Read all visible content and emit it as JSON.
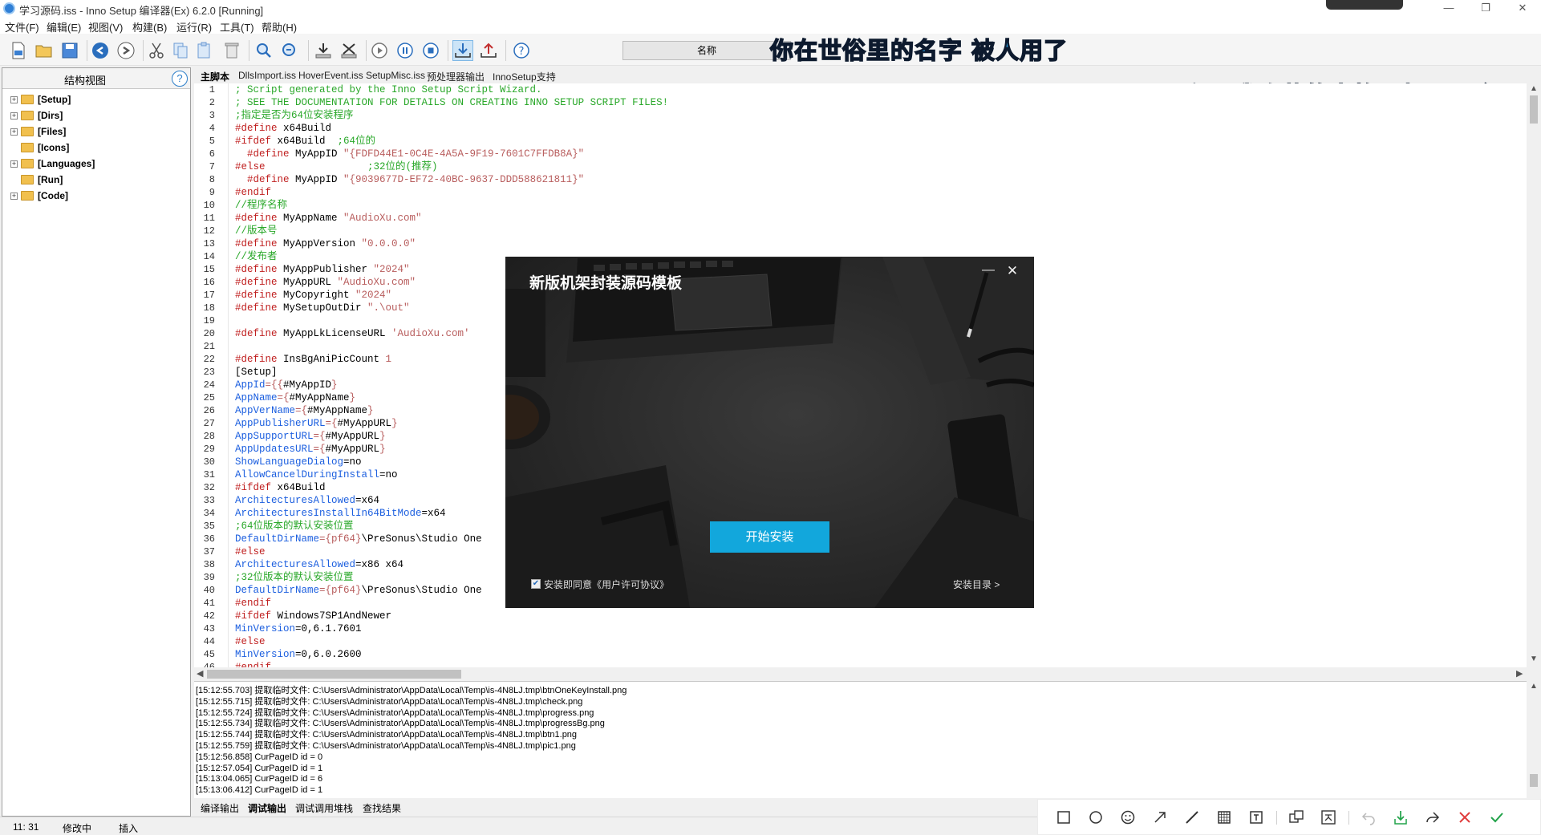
{
  "window": {
    "title": "学习源码.iss - Inno Setup 编译器(Ex) 6.2.0  [Running]",
    "recording_pill": "",
    "controls": [
      "—",
      "❐",
      "✕"
    ]
  },
  "menu": [
    "文件(F)",
    "编辑(E)",
    "视图(V)",
    "构建(B)",
    "运行(R)",
    "工具(T)",
    "帮助(H)"
  ],
  "toolbar": {
    "name_field_label": "名称",
    "icons": [
      "new-file-icon",
      "open-icon",
      "save-icon",
      "undo-icon",
      "redo-icon",
      "cut-icon",
      "copy-icon",
      "paste-icon",
      "delete-icon",
      "find-icon",
      "replace-icon",
      "compile-icon",
      "stop-compile-icon",
      "run-icon",
      "pause-icon",
      "stop-icon",
      "download-icon",
      "upload-icon",
      "help-icon"
    ]
  },
  "overlay": {
    "lyric_1": "你在世俗里的名字  被人用了",
    "lyric_2": "反正  我隐藏的人格是契而不舍"
  },
  "left_panel": {
    "title": "结构视图",
    "help": "?",
    "items": [
      {
        "label": "[Setup]",
        "expandable": true
      },
      {
        "label": "[Dirs]",
        "expandable": true
      },
      {
        "label": "[Files]",
        "expandable": true
      },
      {
        "label": "[Icons]",
        "expandable": false
      },
      {
        "label": "[Languages]",
        "expandable": true
      },
      {
        "label": "[Run]",
        "expandable": false
      },
      {
        "label": "[Code]",
        "expandable": true
      }
    ]
  },
  "tabs": [
    "主脚本",
    "DllsImport.iss",
    "HoverEvent.iss",
    "SetupMisc.iss",
    "预处理器输出",
    "InnoSetup支持"
  ],
  "editor": {
    "lines": [
      {
        "n": "1",
        "parts": [
          {
            "t": "; Script generated by the Inno Setup Script Wizard.",
            "c": "c-comment"
          }
        ]
      },
      {
        "n": "2",
        "parts": [
          {
            "t": "; SEE THE DOCUMENTATION FOR DETAILS ON CREATING INNO SETUP SCRIPT FILES!",
            "c": "c-comment"
          }
        ]
      },
      {
        "n": "3",
        "parts": [
          {
            "t": ";指定是否为64位安装程序",
            "c": "c-comment"
          }
        ]
      },
      {
        "n": "4",
        "parts": [
          {
            "t": "#define",
            "c": "c-def"
          },
          {
            "t": " x64Build",
            "c": ""
          }
        ]
      },
      {
        "n": "5",
        "parts": [
          {
            "t": "#ifdef",
            "c": "c-def"
          },
          {
            "t": " x64Build  ",
            "c": ""
          },
          {
            "t": ";64位的",
            "c": "c-comment"
          }
        ]
      },
      {
        "n": "6",
        "parts": [
          {
            "t": "  #define",
            "c": "c-def"
          },
          {
            "t": " MyAppID ",
            "c": ""
          },
          {
            "t": "\"{FDFD44E1-0C4E-4A5A-9F19-7601C7FFDB8A}\"",
            "c": "c-str"
          }
        ]
      },
      {
        "n": "7",
        "parts": [
          {
            "t": "#else",
            "c": "c-def"
          },
          {
            "t": "                 ",
            "c": ""
          },
          {
            "t": ";32位的(推荐)",
            "c": "c-comment"
          }
        ]
      },
      {
        "n": "8",
        "parts": [
          {
            "t": "  #define",
            "c": "c-def"
          },
          {
            "t": " MyAppID ",
            "c": ""
          },
          {
            "t": "\"{9039677D-EF72-40BC-9637-DDD588621811}\"",
            "c": "c-str"
          }
        ]
      },
      {
        "n": "9",
        "parts": [
          {
            "t": "#endif",
            "c": "c-def"
          }
        ]
      },
      {
        "n": "10",
        "parts": [
          {
            "t": "//程序名称",
            "c": "c-comment"
          }
        ]
      },
      {
        "n": "11",
        "parts": [
          {
            "t": "#define",
            "c": "c-def"
          },
          {
            "t": " MyAppName ",
            "c": ""
          },
          {
            "t": "\"AudioXu.com\"",
            "c": "c-str"
          }
        ]
      },
      {
        "n": "12",
        "parts": [
          {
            "t": "//版本号",
            "c": "c-comment"
          }
        ]
      },
      {
        "n": "13",
        "parts": [
          {
            "t": "#define",
            "c": "c-def"
          },
          {
            "t": " MyAppVersion ",
            "c": ""
          },
          {
            "t": "\"0.0.0.0\"",
            "c": "c-str"
          }
        ]
      },
      {
        "n": "14",
        "parts": [
          {
            "t": "//发布者",
            "c": "c-comment"
          }
        ]
      },
      {
        "n": "15",
        "parts": [
          {
            "t": "#define",
            "c": "c-def"
          },
          {
            "t": " MyAppPublisher ",
            "c": ""
          },
          {
            "t": "\"2024\"",
            "c": "c-str"
          }
        ]
      },
      {
        "n": "16",
        "parts": [
          {
            "t": "#define",
            "c": "c-def"
          },
          {
            "t": " MyAppURL ",
            "c": ""
          },
          {
            "t": "\"AudioXu.com\"",
            "c": "c-str"
          }
        ]
      },
      {
        "n": "17",
        "parts": [
          {
            "t": "#define",
            "c": "c-def"
          },
          {
            "t": " MyCopyright ",
            "c": ""
          },
          {
            "t": "\"2024\"",
            "c": "c-str"
          }
        ]
      },
      {
        "n": "18",
        "parts": [
          {
            "t": "#define",
            "c": "c-def"
          },
          {
            "t": " MySetupOutDir ",
            "c": ""
          },
          {
            "t": "\".\\out\"",
            "c": "c-str"
          }
        ]
      },
      {
        "n": "19",
        "parts": []
      },
      {
        "n": "20",
        "parts": [
          {
            "t": "#define",
            "c": "c-def"
          },
          {
            "t": " MyAppLkLicenseURL ",
            "c": ""
          },
          {
            "t": "'AudioXu.com'",
            "c": "c-str"
          }
        ]
      },
      {
        "n": "21",
        "parts": []
      },
      {
        "n": "22",
        "parts": [
          {
            "t": "#define",
            "c": "c-def"
          },
          {
            "t": " InsBgAniPicCount ",
            "c": ""
          },
          {
            "t": "1",
            "c": "c-str"
          }
        ]
      },
      {
        "n": "23",
        "parts": [
          {
            "t": "[Setup]",
            "c": ""
          }
        ]
      },
      {
        "n": "24",
        "parts": [
          {
            "t": "AppId",
            "c": "c-prop"
          },
          {
            "t": "={{",
            "c": "c-str"
          },
          {
            "t": "#MyAppID",
            "c": ""
          },
          {
            "t": "}",
            "c": "c-str"
          }
        ]
      },
      {
        "n": "25",
        "parts": [
          {
            "t": "AppName",
            "c": "c-prop"
          },
          {
            "t": "={",
            "c": "c-str"
          },
          {
            "t": "#MyAppName",
            "c": ""
          },
          {
            "t": "}",
            "c": "c-str"
          }
        ]
      },
      {
        "n": "26",
        "parts": [
          {
            "t": "AppVerName",
            "c": "c-prop"
          },
          {
            "t": "={",
            "c": "c-str"
          },
          {
            "t": "#MyAppName",
            "c": ""
          },
          {
            "t": "}",
            "c": "c-str"
          }
        ]
      },
      {
        "n": "27",
        "parts": [
          {
            "t": "AppPublisherURL",
            "c": "c-prop"
          },
          {
            "t": "={",
            "c": "c-str"
          },
          {
            "t": "#MyAppURL",
            "c": ""
          },
          {
            "t": "}",
            "c": "c-str"
          }
        ]
      },
      {
        "n": "28",
        "parts": [
          {
            "t": "AppSupportURL",
            "c": "c-prop"
          },
          {
            "t": "={",
            "c": "c-str"
          },
          {
            "t": "#MyAppURL",
            "c": ""
          },
          {
            "t": "}",
            "c": "c-str"
          }
        ]
      },
      {
        "n": "29",
        "parts": [
          {
            "t": "AppUpdatesURL",
            "c": "c-prop"
          },
          {
            "t": "={",
            "c": "c-str"
          },
          {
            "t": "#MyAppURL",
            "c": ""
          },
          {
            "t": "}",
            "c": "c-str"
          }
        ]
      },
      {
        "n": "30",
        "parts": [
          {
            "t": "ShowLanguageDialog",
            "c": "c-prop"
          },
          {
            "t": "=no",
            "c": ""
          }
        ]
      },
      {
        "n": "31",
        "parts": [
          {
            "t": "AllowCancelDuringInstall",
            "c": "c-prop"
          },
          {
            "t": "=no",
            "c": ""
          }
        ]
      },
      {
        "n": "32",
        "parts": [
          {
            "t": "#ifdef",
            "c": "c-def"
          },
          {
            "t": " x64Build",
            "c": ""
          }
        ]
      },
      {
        "n": "33",
        "parts": [
          {
            "t": "ArchitecturesAllowed",
            "c": "c-prop"
          },
          {
            "t": "=x64",
            "c": ""
          }
        ]
      },
      {
        "n": "34",
        "parts": [
          {
            "t": "ArchitecturesInstallIn64BitMode",
            "c": "c-prop"
          },
          {
            "t": "=x64",
            "c": ""
          }
        ]
      },
      {
        "n": "35",
        "parts": [
          {
            "t": ";64位版本的默认安装位置",
            "c": "c-comment"
          }
        ]
      },
      {
        "n": "36",
        "parts": [
          {
            "t": "DefaultDirName",
            "c": "c-prop"
          },
          {
            "t": "={pf64}",
            "c": "c-str"
          },
          {
            "t": "\\PreSonus\\Studio One",
            "c": ""
          }
        ]
      },
      {
        "n": "37",
        "parts": [
          {
            "t": "#else",
            "c": "c-def"
          }
        ]
      },
      {
        "n": "38",
        "parts": [
          {
            "t": "ArchitecturesAllowed",
            "c": "c-prop"
          },
          {
            "t": "=x86 x64",
            "c": ""
          }
        ]
      },
      {
        "n": "39",
        "parts": [
          {
            "t": ";32位版本的默认安装位置",
            "c": "c-comment"
          }
        ]
      },
      {
        "n": "40",
        "parts": [
          {
            "t": "DefaultDirName",
            "c": "c-prop"
          },
          {
            "t": "={pf64}",
            "c": "c-str"
          },
          {
            "t": "\\PreSonus\\Studio One",
            "c": ""
          }
        ]
      },
      {
        "n": "41",
        "parts": [
          {
            "t": "#endif",
            "c": "c-def"
          }
        ]
      },
      {
        "n": "42",
        "parts": [
          {
            "t": "#ifdef",
            "c": "c-def"
          },
          {
            "t": " Windows7SP1AndNewer",
            "c": ""
          }
        ]
      },
      {
        "n": "43",
        "parts": [
          {
            "t": "MinVersion",
            "c": "c-prop"
          },
          {
            "t": "=0,6.1.7601",
            "c": ""
          }
        ]
      },
      {
        "n": "44",
        "parts": [
          {
            "t": "#else",
            "c": "c-def"
          }
        ]
      },
      {
        "n": "45",
        "parts": [
          {
            "t": "MinVersion",
            "c": "c-prop"
          },
          {
            "t": "=0,6.0.2600",
            "c": ""
          }
        ]
      },
      {
        "n": "46",
        "parts": [
          {
            "t": "#endif",
            "c": "c-def"
          }
        ]
      }
    ]
  },
  "log": [
    "[15:12:55.703]   提取临时文件: C:\\Users\\Administrator\\AppData\\Local\\Temp\\is-4N8LJ.tmp\\btnOneKeyInstall.png",
    "[15:12:55.715]   提取临时文件: C:\\Users\\Administrator\\AppData\\Local\\Temp\\is-4N8LJ.tmp\\check.png",
    "[15:12:55.724]   提取临时文件: C:\\Users\\Administrator\\AppData\\Local\\Temp\\is-4N8LJ.tmp\\progress.png",
    "[15:12:55.734]   提取临时文件: C:\\Users\\Administrator\\AppData\\Local\\Temp\\is-4N8LJ.tmp\\progressBg.png",
    "[15:12:55.744]   提取临时文件: C:\\Users\\Administrator\\AppData\\Local\\Temp\\is-4N8LJ.tmp\\btn1.png",
    "[15:12:55.759]   提取临时文件: C:\\Users\\Administrator\\AppData\\Local\\Temp\\is-4N8LJ.tmp\\pic1.png",
    "[15:12:56.858]   CurPageID id = 0",
    "[15:12:57.054]   CurPageID id = 1",
    "[15:13:04.065]   CurPageID id = 6",
    "[15:13:06.412]   CurPageID id = 1"
  ],
  "bottom_tabs": [
    "编译输出",
    "调试输出",
    "调试调用堆栈",
    "查找结果"
  ],
  "status": {
    "position": "11:  31",
    "modified": "修改中",
    "mode": "插入"
  },
  "annotation_toolbar": [
    "rectangle-icon",
    "ellipse-icon",
    "emoji-icon",
    "arrow-icon",
    "pen-icon",
    "mosaic-icon",
    "text-icon",
    "pin-icon",
    "translate-icon",
    "undo-icon",
    "save-icon",
    "share-icon",
    "cancel-icon",
    "confirm-icon"
  ],
  "dialog": {
    "title": "新版机架封装源码模板",
    "minimize": "—",
    "close": "✕",
    "install_button": "开始安装",
    "agree_text": "安装即同意《用户许可协议》",
    "agree_checked": true,
    "dir_link": "安装目录  >",
    "accent_color": "#12a7dc"
  }
}
